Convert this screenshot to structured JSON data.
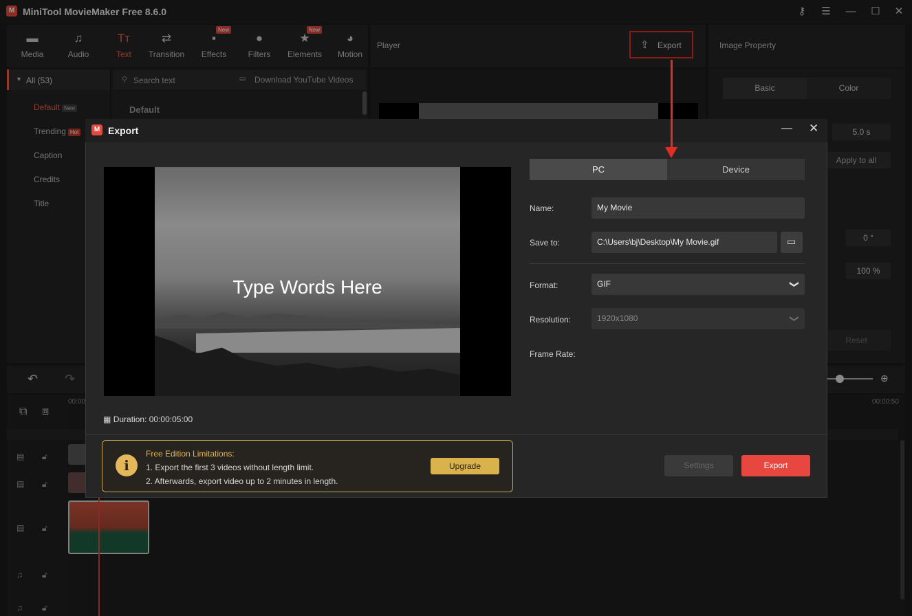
{
  "app": {
    "title": "MiniTool MovieMaker Free 8.6.0",
    "logo_glyph": "M"
  },
  "toolbar": {
    "items": [
      {
        "label": "Media",
        "icon": "folder-icon"
      },
      {
        "label": "Audio",
        "icon": "music-note-icon"
      },
      {
        "label": "Text",
        "icon": "text-icon"
      },
      {
        "label": "Transition",
        "icon": "transition-icon"
      },
      {
        "label": "Effects",
        "icon": "effects-icon",
        "badge": "New"
      },
      {
        "label": "Filters",
        "icon": "filters-icon"
      },
      {
        "label": "Elements",
        "icon": "elements-icon",
        "badge": "New"
      },
      {
        "label": "Motion",
        "icon": "motion-icon"
      }
    ],
    "active": "Text"
  },
  "categories": {
    "all_label": "All (53)",
    "items": [
      {
        "label": "Default",
        "tag": "New"
      },
      {
        "label": "Trending",
        "tag": "Hot"
      },
      {
        "label": "Caption"
      },
      {
        "label": "Credits"
      },
      {
        "label": "Title"
      }
    ]
  },
  "text_panel": {
    "search_placeholder": "Search text",
    "download_label": "Download YouTube Videos",
    "section_title": "Default"
  },
  "player": {
    "title": "Player",
    "export_label": "Export"
  },
  "property": {
    "title": "Image Property",
    "tabs": [
      "Basic",
      "Color"
    ],
    "duration": "5.0 s",
    "apply_all": "Apply to all",
    "rotation": "0 °",
    "scale": "100 %",
    "reset": "Reset"
  },
  "timeline": {
    "time_start": "00:00",
    "time_end": "00:00:50"
  },
  "dialog": {
    "title": "Export",
    "preview_text": "Type Words Here",
    "duration_label": "Duration:",
    "duration_value": "00:00:05:00",
    "tabs": {
      "pc": "PC",
      "device": "Device"
    },
    "name_label": "Name:",
    "name_value": "My Movie",
    "save_label": "Save to:",
    "save_value": "C:\\Users\\bj\\Desktop\\My Movie.gif",
    "format_label": "Format:",
    "format_value": "GIF",
    "resolution_label": "Resolution:",
    "resolution_value": "1920x1080",
    "framerate_label": "Frame Rate:",
    "limit_title": "Free Edition Limitations:",
    "limit_line1": "1. Export the first 3 videos without length limit.",
    "limit_line2": "2. Afterwards, export video up to 2 minutes in length.",
    "upgrade_label": "Upgrade",
    "settings_label": "Settings",
    "export_label": "Export"
  },
  "colors": {
    "accent": "#e8473f",
    "highlight_border": "#e02d22",
    "gold": "#d9b24c"
  }
}
